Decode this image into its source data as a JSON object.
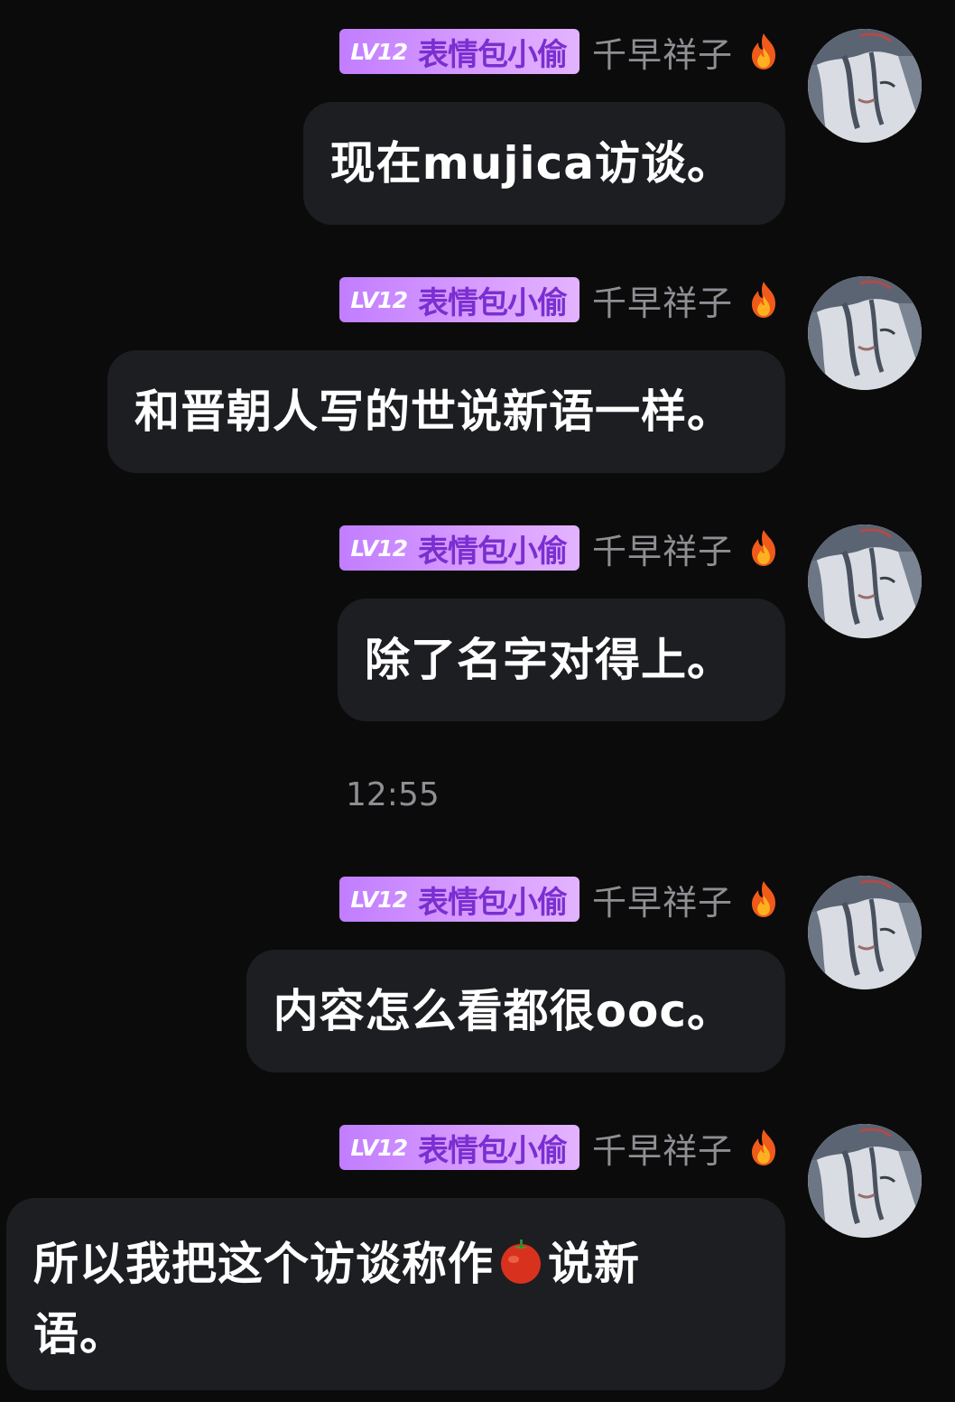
{
  "sender": {
    "level": "LV12",
    "badge_title": "表情包小偷",
    "name": "千早祥子",
    "flame_icon": "fire-icon",
    "avatar_icon": "anime-avatar-icon"
  },
  "timestamp": "12:55",
  "colors": {
    "background": "#0b0b0c",
    "bubble": "#1d1e22",
    "badge_gradient_start": "#c17dff",
    "badge_gradient_end": "#e3b3ff",
    "badge_text": "#7a2fd0",
    "username": "#8e8e93"
  },
  "messages": [
    {
      "text": "现在mujica访谈。"
    },
    {
      "text": "和晋朝人写的世说新语一样。"
    },
    {
      "text": "除了名字对得上。"
    },
    {
      "text": "内容怎么看都很ooc。"
    },
    {
      "text_before_emoji": "所以我把这个访谈称作",
      "emoji": "tomato-icon",
      "text_after_emoji": "说新语。"
    }
  ]
}
